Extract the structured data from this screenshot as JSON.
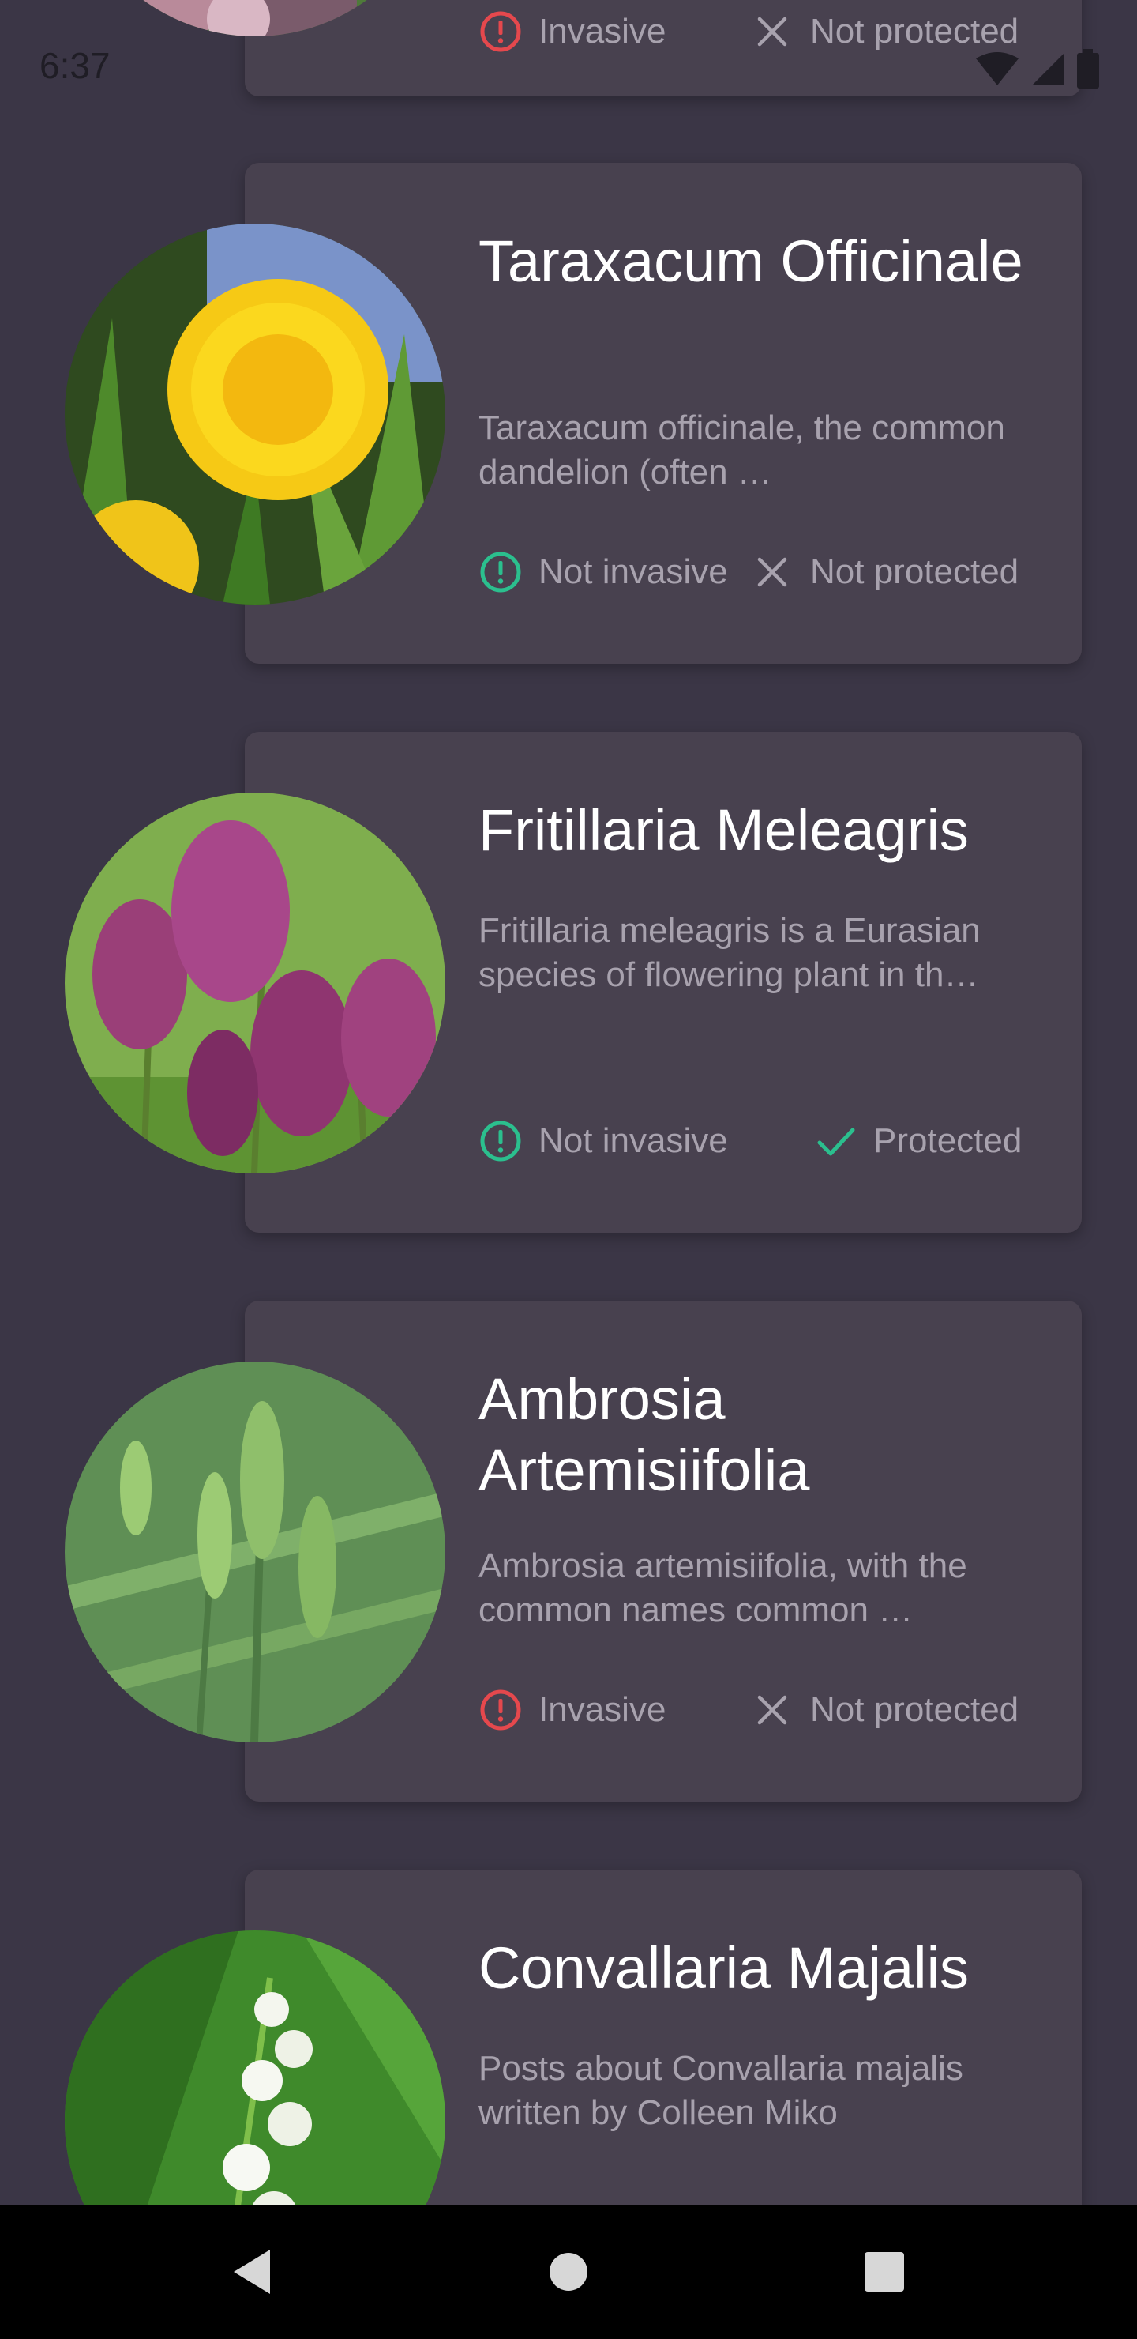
{
  "status_bar": {
    "time": "6:37"
  },
  "cards": [
    {
      "title": "",
      "description": "",
      "invasive_label": "Invasive",
      "protected_label": "Not protected"
    },
    {
      "title": "Taraxacum Officinale",
      "description": "Taraxacum officinale, the common dandelion (often …",
      "invasive_label": "Not invasive",
      "protected_label": "Not protected"
    },
    {
      "title": "Fritillaria Meleagris",
      "description": "Fritillaria meleagris is a Eurasian species of flowering plant in th…",
      "invasive_label": "Not invasive",
      "protected_label": "Protected"
    },
    {
      "title": "Ambrosia Artemisiifolia",
      "description": "Ambrosia artemisiifolia, with the common names common …",
      "invasive_label": "Invasive",
      "protected_label": "Not protected"
    },
    {
      "title": "Convallaria Majalis",
      "description": "Posts about Convallaria majalis written by Colleen Miko",
      "invasive_label": "",
      "protected_label": ""
    }
  ],
  "colors": {
    "background": "#3b3646",
    "card": "#48414f",
    "safe_green": "#2bbf8e",
    "danger_red": "#e5484d",
    "muted_text": "#a8a2ae"
  },
  "icons": {
    "not_invasive": "alert-circle-icon",
    "invasive": "alert-circle-icon",
    "protected": "check-icon",
    "not_protected": "close-icon"
  }
}
